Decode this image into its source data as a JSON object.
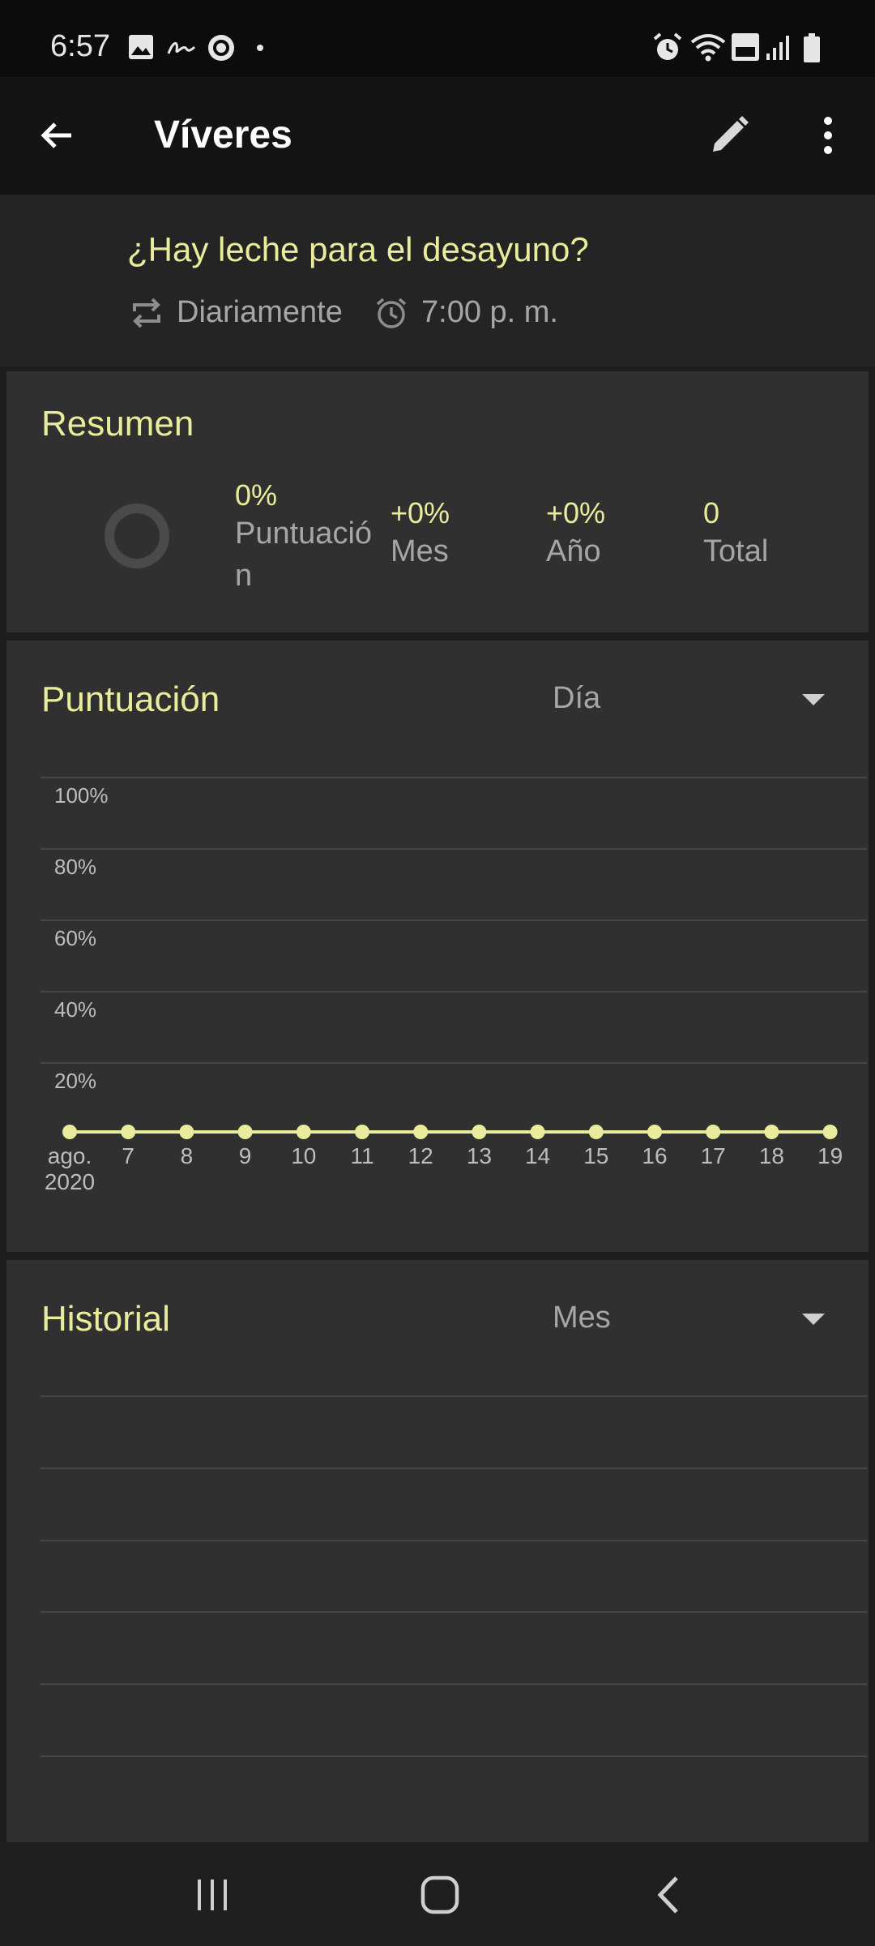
{
  "status_bar": {
    "time": "6:57"
  },
  "app_bar": {
    "title": "Víveres"
  },
  "habit": {
    "question": "¿Hay leche para el desayuno?",
    "frequency": "Diariamente",
    "reminder": "7:00 p. m."
  },
  "summary": {
    "title": "Resumen",
    "score_value": "0%",
    "score_label": "Puntuació n",
    "month_value": "+0%",
    "month_label": "Mes",
    "year_value": "+0%",
    "year_label": "Año",
    "total_value": "0",
    "total_label": "Total"
  },
  "score_card": {
    "title": "Puntuación",
    "period": "Día"
  },
  "history_card": {
    "title": "Historial",
    "period": "Mes"
  },
  "colors": {
    "accent": "#e8ec9c",
    "card": "#303030",
    "background": "#1d1d1d"
  },
  "chart_data": {
    "type": "line",
    "y_ticks": [
      "100%",
      "80%",
      "60%",
      "40%",
      "20%"
    ],
    "x_labels": [
      "ago.",
      "7",
      "8",
      "9",
      "10",
      "11",
      "12",
      "13",
      "14",
      "15",
      "16",
      "17",
      "18",
      "19"
    ],
    "x_sublabel": "2020",
    "values": [
      0,
      0,
      0,
      0,
      0,
      0,
      0,
      0,
      0,
      0,
      0,
      0,
      0,
      0
    ],
    "ylim": [
      0,
      100
    ]
  }
}
